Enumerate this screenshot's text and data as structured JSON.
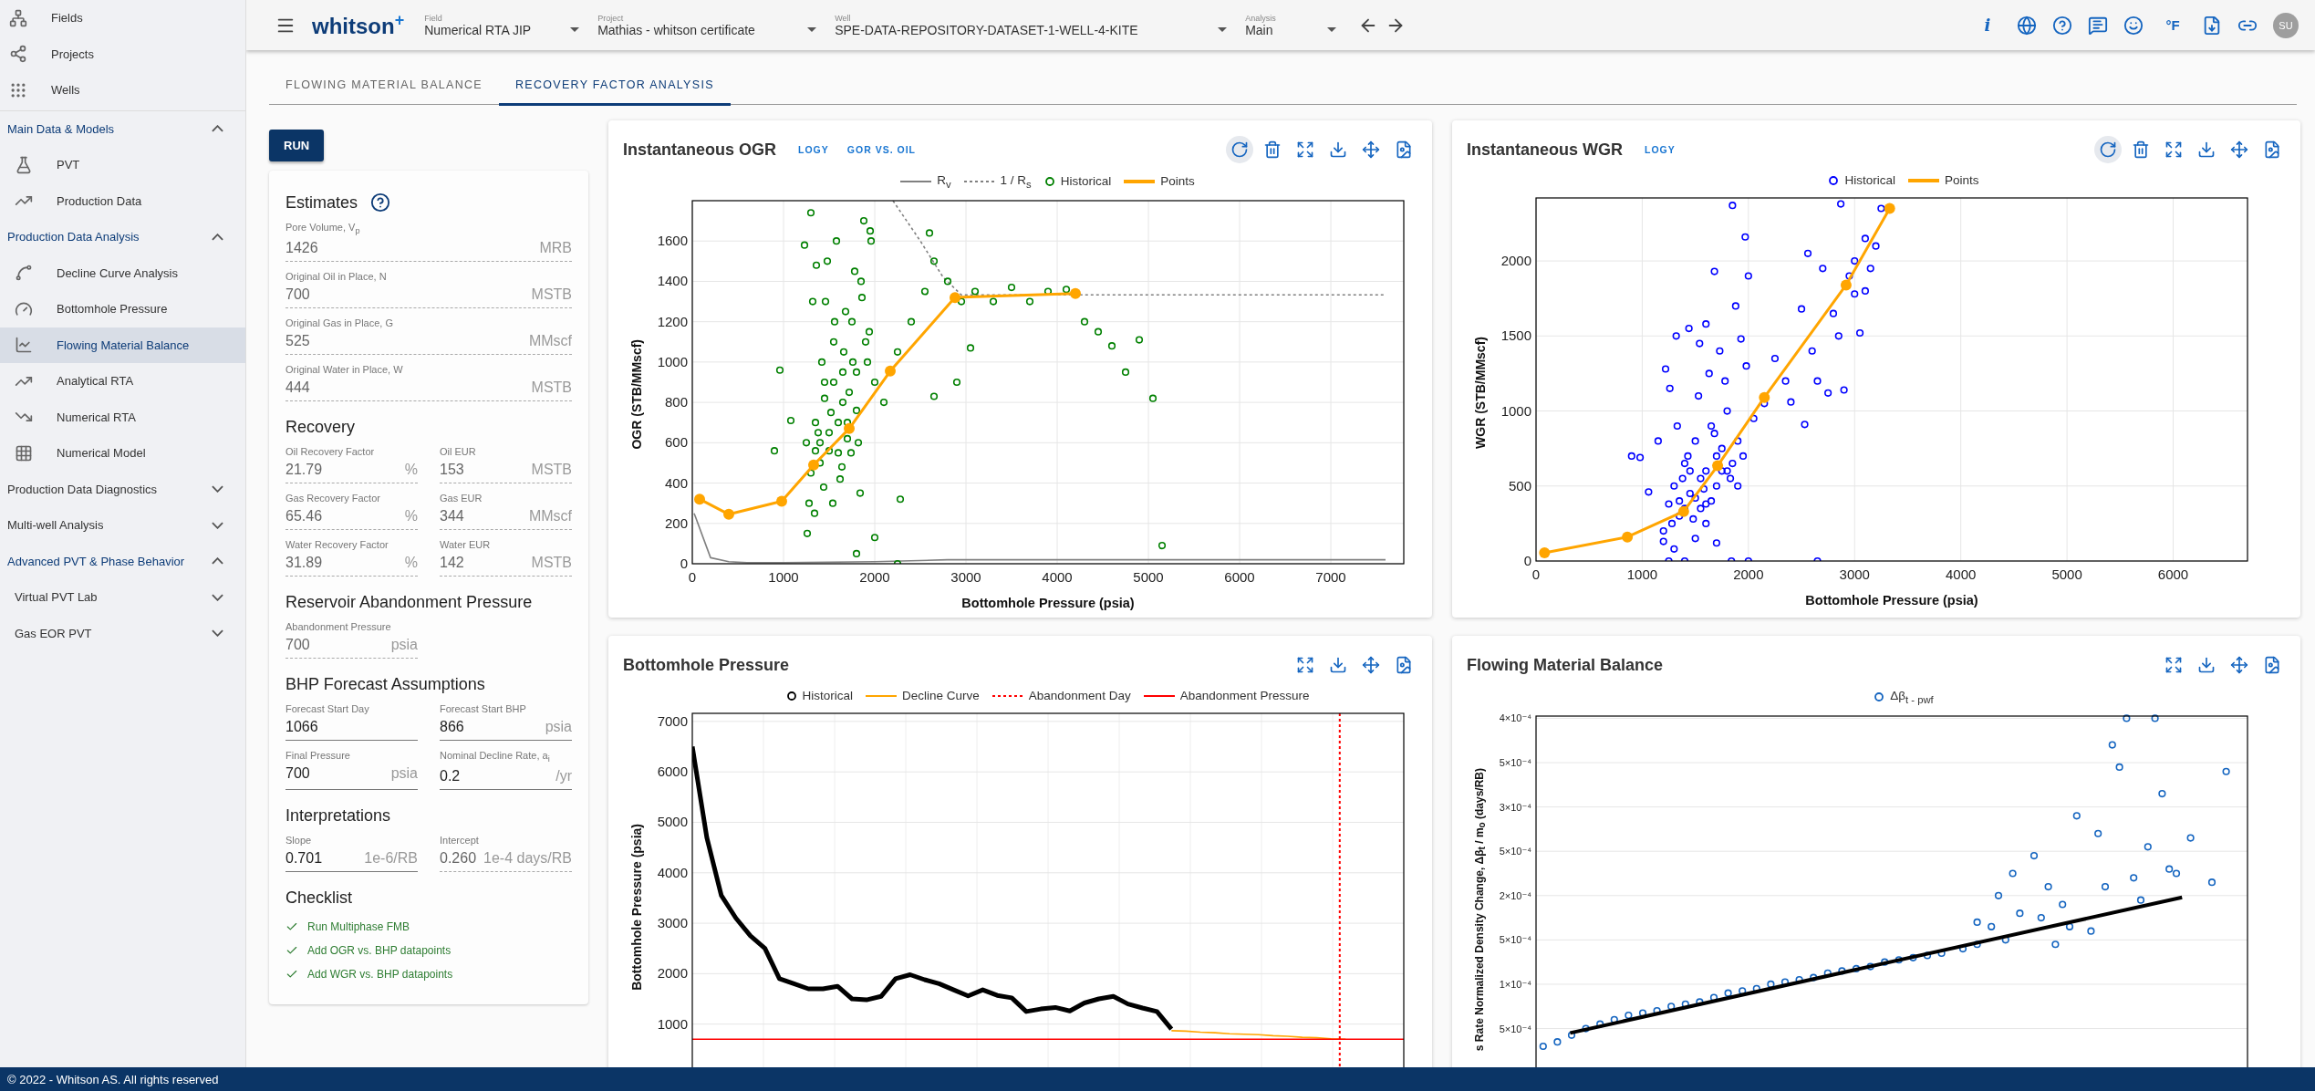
{
  "sidebar": {
    "top_links": [
      {
        "label": "Fields"
      },
      {
        "label": "Projects"
      },
      {
        "label": "Wells"
      }
    ],
    "sections": [
      {
        "label": "Main Data & Models",
        "expanded": true,
        "children": [
          {
            "label": "PVT",
            "kind": "link",
            "selected": false
          },
          {
            "label": "Production Data",
            "kind": "link",
            "selected": false
          }
        ]
      },
      {
        "label": "Production Data Analysis",
        "expanded": true,
        "children": [
          {
            "label": "Decline Curve Analysis",
            "kind": "link",
            "selected": false
          },
          {
            "label": "Bottomhole Pressure",
            "kind": "link",
            "selected": false
          },
          {
            "label": "Flowing Material Balance",
            "kind": "link",
            "selected": true
          },
          {
            "label": "Analytical RTA",
            "kind": "link",
            "selected": false
          },
          {
            "label": "Numerical RTA",
            "kind": "link",
            "selected": false
          },
          {
            "label": "Numerical Model",
            "kind": "link",
            "selected": false
          }
        ]
      },
      {
        "label": "Production Data Diagnostics",
        "expanded": false
      },
      {
        "label": "Multi-well Analysis",
        "expanded": false
      },
      {
        "label": "Advanced PVT & Phase Behavior",
        "expanded": true,
        "children": [
          {
            "label": "Virtual PVT Lab",
            "kind": "group",
            "expanded": false
          },
          {
            "label": "Gas EOR PVT",
            "kind": "group",
            "expanded": false
          }
        ]
      }
    ]
  },
  "topbar": {
    "logo": "whitson",
    "logo_mark": "+",
    "selects": [
      {
        "label": "Field",
        "value": "Numerical RTA JIP"
      },
      {
        "label": "Project",
        "value": "Mathias - whitson certificate"
      },
      {
        "label": "Well",
        "value": "SPE-DATA-REPOSITORY-DATASET-1-WELL-4-KITE"
      },
      {
        "label": "Analysis",
        "value": "Main"
      }
    ],
    "info_glyph": "i",
    "units": "°F",
    "avatar": "SU"
  },
  "tabs": [
    {
      "label": "FLOWING MATERIAL BALANCE",
      "selected": false
    },
    {
      "label": "RECOVERY FACTOR ANALYSIS",
      "selected": true
    }
  ],
  "run_button": "RUN",
  "panel": [
    {
      "title": "Estimates",
      "help": true,
      "fields": [
        {
          "label": "Pore Volume, V$_{p}$",
          "value": "1426",
          "unit": "MRB",
          "editable": false
        },
        {
          "label": "Original Oil in Place, N",
          "value": "700",
          "unit": "MSTB",
          "editable": false
        },
        {
          "label": "Original Gas in Place, G",
          "value": "525",
          "unit": "MMscf",
          "editable": false
        },
        {
          "label": "Original Water in Place, W",
          "value": "444",
          "unit": "MSTB",
          "editable": false
        }
      ]
    },
    {
      "title": "Recovery",
      "fields": [
        {
          "label": "Oil Recovery Factor",
          "value": "21.79",
          "unit": "%",
          "editable": false
        },
        {
          "label": "Oil EUR",
          "value": "153",
          "unit": "MSTB",
          "editable": false
        },
        {
          "label": "Gas Recovery Factor",
          "value": "65.46",
          "unit": "%",
          "editable": false
        },
        {
          "label": "Gas EUR",
          "value": "344",
          "unit": "MMscf",
          "editable": false
        },
        {
          "label": "Water Recovery Factor",
          "value": "31.89",
          "unit": "%",
          "editable": false
        },
        {
          "label": "Water EUR",
          "value": "142",
          "unit": "MSTB",
          "editable": false
        }
      ]
    },
    {
      "title": "Reservoir Abandonment Pressure",
      "fields": [
        {
          "label": "Abandonment Pressure",
          "value": "700",
          "unit": "psia",
          "editable": false
        }
      ]
    },
    {
      "title": "BHP Forecast Assumptions",
      "fields": [
        {
          "label": "Forecast Start Day",
          "value": "1066",
          "editable": true
        },
        {
          "label": "Forecast Start BHP",
          "value": "866",
          "unit": "psia",
          "editable": true
        },
        {
          "label": "Final Pressure",
          "value": "700",
          "unit": "psia",
          "editable": true
        },
        {
          "label": "Nominal Decline Rate, a$_{i}$",
          "value": "0.2",
          "unit": "/yr",
          "editable": true
        }
      ]
    },
    {
      "title": "Interpretations",
      "fields": [
        {
          "label": "Slope",
          "value": "0.701",
          "unit": "1e-6/RB",
          "editable": true
        },
        {
          "label": "Intercept",
          "value": "0.260",
          "unit": "1e-4 days/RB",
          "editable": false
        }
      ]
    }
  ],
  "checklist": {
    "title": "Checklist",
    "items": [
      {
        "label": "Run Multiphase FMB",
        "checked": true
      },
      {
        "label": "Add OGR vs. BHP datapoints",
        "checked": true
      },
      {
        "label": "Add WGR vs. BHP datapoints",
        "checked": true
      }
    ]
  },
  "charts": [
    {
      "title": "Instantaneous OGR",
      "actions": [
        "LOGY",
        "GOR VS. OIL"
      ],
      "point_tools": true,
      "chart_data": {
        "type": "scatter",
        "grid": true,
        "xlabel": "Bottomhole Pressure (psia)",
        "ylabel": "OGR (STB/MMscf)",
        "xlim": [
          0,
          7800
        ],
        "ylim": [
          0,
          1800
        ],
        "xticks": [
          0,
          1000,
          2000,
          3000,
          4000,
          5000,
          6000,
          7000
        ],
        "yticks": [
          0,
          200,
          400,
          600,
          800,
          1000,
          1200,
          1400,
          1600
        ],
        "series": [
          {
            "name": "R$_{v}$",
            "type": "line",
            "color": "#808080",
            "x": [
              20,
              200,
              400,
              600,
              1000,
              2000,
              2800,
              7600
            ],
            "values": [
              250,
              30,
              10,
              5,
              5,
              10,
              20,
              20
            ]
          },
          {
            "name": "1 / R$_{s}$",
            "type": "line",
            "line_style": "dotted",
            "color": "#808080",
            "x": [
              2200,
              2500,
              2750,
              2950,
              7600
            ],
            "values": [
              1800,
              1600,
              1420,
              1333,
              1333
            ]
          },
          {
            "name": "Historical",
            "color": "#008000",
            "x": [
              1250,
              1300,
              1350,
              1400,
              1450,
              1500,
              1550,
              1600,
              1650,
              1700,
              1750,
              1800,
              1850,
              1900,
              1950,
              2000,
              1280,
              1320,
              1380,
              1420,
              1480,
              1520,
              1580,
              1620,
              1680,
              1720,
              1780,
              1820,
              1880,
              1920,
              1260,
              1340,
              1440,
              1540,
              1640,
              1740,
              1840,
              1940,
              1230,
              1300,
              1360,
              1460,
              1560,
              1660,
              1760,
              1860,
              1960,
              1400,
              1500,
              1600,
              1700,
              1800,
              1350,
              1450,
              1550,
              1650,
              900,
              960,
              1080,
              2100,
              2250,
              2400,
              2550,
              2650,
              2800,
              2950,
              3100,
              3300,
              3500,
              3700,
              3900,
              4100,
              2600,
              2900,
              3050,
              2650,
              4300,
              4450,
              4600,
              4750,
              4900,
              5050,
              5150,
              2280,
              2000,
              1800,
              2250
            ],
            "values": [
              600,
              450,
              700,
              500,
              900,
              650,
              1100,
              550,
              800,
              700,
              1200,
              950,
              1400,
              1100,
              1650,
              900,
              300,
              1300,
              650,
              1000,
              1500,
              750,
              1600,
              420,
              1250,
              850,
              1450,
              600,
              1700,
              1000,
              150,
              250,
              380,
              300,
              480,
              550,
              350,
              1150,
              1580,
              1740,
              1480,
              1300,
              1200,
              1050,
              1000,
              1320,
              1600,
              600,
              560,
              700,
              620,
              760,
              560,
              820,
              900,
              950,
              560,
              960,
              710,
              800,
              1050,
              1200,
              1350,
              1500,
              1400,
              1300,
              1350,
              1300,
              1370,
              1300,
              1350,
              1360,
              1640,
              900,
              1070,
              830,
              1200,
              1150,
              1080,
              950,
              1110,
              820,
              90,
              320,
              130,
              50,
              0
            ]
          },
          {
            "name": "Points",
            "type": "line",
            "marker": true,
            "color": "#ffa500",
            "x": [
              80,
              400,
              980,
              1330,
              1720,
              2170,
              2880,
              4200
            ],
            "values": [
              320,
              245,
              310,
              490,
              670,
              955,
              1320,
              1340
            ]
          }
        ]
      }
    },
    {
      "title": "Instantaneous WGR",
      "actions": [
        "LOGY"
      ],
      "point_tools": true,
      "chart_data": {
        "type": "scatter",
        "grid": true,
        "xlabel": "Bottomhole Pressure (psia)",
        "ylabel": "WGR (STB/MMscf)",
        "xlim": [
          0,
          6700
        ],
        "ylim": [
          0,
          2420
        ],
        "xticks": [
          0,
          1000,
          2000,
          3000,
          4000,
          5000,
          6000
        ],
        "yticks": [
          0,
          500,
          1000,
          1500,
          2000
        ],
        "series": [
          {
            "name": "Historical",
            "color": "#0000ff",
            "x": [
              1250,
              1300,
              1350,
              1400,
              1450,
              1500,
              1550,
              1600,
              1650,
              1700,
              1750,
              1800,
              1850,
              1900,
              1950,
              1280,
              1330,
              1380,
              1430,
              1480,
              1530,
              1580,
              1630,
              1680,
              1730,
              1780,
              1830,
              1880,
              1930,
              1980,
              1220,
              1260,
              1320,
              1440,
              1540,
              1600,
              1680,
              1850,
              1970,
              2000,
              1200,
              1300,
              1400,
              1250,
              1500,
              1700,
              1840,
              2000,
              2650,
              900,
              980,
              1060,
              1150,
              2050,
              2150,
              2250,
              2350,
              2400,
              2500,
              2530,
              2560,
              2600,
              2650,
              2700,
              2750,
              2800,
              2850,
              2900,
              2950,
              3000,
              3050,
              3100,
              3150,
              3200,
              3250,
              2870,
              3000,
              3100,
              1350,
              1450,
              1550,
              1650,
              1750,
              1400,
              1500,
              1600,
              1700,
              1800,
              1900,
              1200,
              1600
            ],
            "values": [
              380,
              500,
              300,
              650,
              450,
              800,
              350,
              600,
              900,
              500,
              750,
              1000,
              650,
              800,
              700,
              250,
              900,
              550,
              700,
              280,
              1100,
              480,
              1250,
              850,
              1400,
              1200,
              550,
              1700,
              1480,
              1300,
              1280,
              1150,
              1500,
              1550,
              1450,
              1580,
              1930,
              2370,
              2160,
              1900,
              130,
              80,
              0,
              0,
              150,
              120,
              0,
              0,
              0,
              700,
              690,
              460,
              800,
              950,
              1050,
              1350,
              1200,
              1060,
              1680,
              910,
              2050,
              1400,
              1200,
              1950,
              1120,
              1650,
              1500,
              1140,
              1900,
              2000,
              1520,
              2150,
              1950,
              2100,
              2350,
              2380,
              1780,
              1800,
              400,
              600,
              550,
              400,
              600,
              350,
              420,
              380,
              700,
              600,
              500,
              200,
              250
            ]
          },
          {
            "name": "Points",
            "type": "line",
            "marker": true,
            "color": "#ffa500",
            "x": [
              80,
              860,
              1390,
              1710,
              2150,
              2920,
              3330
            ],
            "values": [
              55,
              160,
              330,
              635,
              1090,
              1840,
              2350
            ]
          }
        ]
      }
    },
    {
      "title": "Bottomhole Pressure",
      "vertical_marker": {
        "label": "Abandonment Day",
        "color": "#ff0000"
      },
      "chart_data": {
        "type": "line",
        "grid": true,
        "ylabel": "Bottomhole Pressure (psia)",
        "categories": [
          null,
          null,
          null,
          null,
          null,
          null,
          null,
          null,
          null,
          null,
          null,
          null,
          null,
          null,
          null,
          null,
          null,
          null,
          null,
          null,
          null,
          null,
          null,
          null,
          null,
          null,
          null,
          null,
          null,
          null,
          null,
          null,
          null,
          null,
          null,
          null,
          null,
          null,
          null,
          null,
          null,
          null,
          null,
          null,
          null,
          null,
          null,
          null,
          null,
          null
        ],
        "ylim": [
          0,
          7160
        ],
        "yticks": [
          1000,
          2000,
          3000,
          4000,
          5000,
          6000,
          7000
        ],
        "series": [
          {
            "name": "Historical",
            "color": "#000000",
            "values": [
              6500,
              4700,
              3550,
              3100,
              2750,
              2500,
              1900,
              1800,
              1700,
              1700,
              1750,
              1500,
              1480,
              1550,
              1900,
              1980,
              1880,
              1800,
              1680,
              1560,
              1680,
              1570,
              1520,
              1250,
              1300,
              1330,
              1260,
              1420,
              1500,
              1550,
              1400,
              1320,
              1250,
              900,
              null,
              null,
              null,
              null,
              null,
              null,
              null,
              null,
              null,
              null,
              null,
              null,
              null,
              null,
              null,
              null
            ]
          },
          {
            "name": "Decline Curve",
            "color": "#ffa500",
            "values": [
              null,
              null,
              null,
              null,
              null,
              null,
              null,
              null,
              null,
              null,
              null,
              null,
              null,
              null,
              null,
              null,
              null,
              null,
              null,
              null,
              null,
              null,
              null,
              null,
              null,
              null,
              null,
              null,
              null,
              null,
              null,
              null,
              null,
              870,
              860,
              840,
              830,
              810,
              800,
              790,
              770,
              760,
              740,
              730,
              710,
              700,
              null,
              null,
              null,
              null
            ]
          },
          {
            "name": "Abandonment Pressure",
            "color": "#ff0000",
            "values": [
              700,
              700,
              700,
              700,
              700,
              700,
              700,
              700,
              700,
              700,
              700,
              700,
              700,
              700,
              700,
              700,
              700,
              700,
              700,
              700,
              700,
              700,
              700,
              700,
              700,
              700,
              700,
              700,
              700,
              700,
              700,
              700,
              700,
              700,
              700,
              700,
              700,
              700,
              700,
              700,
              700,
              700,
              700,
              700,
              700,
              700,
              700,
              700,
              700,
              700
            ]
          }
        ]
      }
    },
    {
      "title": "Flowing Material Balance",
      "picture": {
        "legend": "Δβ$_{t - pwf}$",
        "ylabel": "s Rate Normalized Density Change, Δβ$_{t}$ / m$_{o}$ (days/RB)",
        "ytick_labels": [
          "4×10⁻⁴",
          "5×10⁻⁴",
          "3×10⁻⁴",
          "5×10⁻⁴",
          "2×10⁻⁴",
          "5×10⁻⁴",
          "1×10⁻⁴",
          "5×10⁻⁴"
        ]
      }
    }
  ],
  "footer": "© 2022 - Whitson AS. All rights reserved"
}
